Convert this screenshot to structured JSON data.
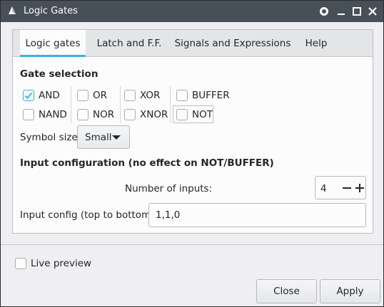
{
  "window": {
    "title": "Logic Gates"
  },
  "titlebar_buttons": [
    "pin-icon",
    "minimize-icon",
    "maximize-icon",
    "close-icon"
  ],
  "tabs": [
    {
      "label": "Logic gates",
      "active": true
    },
    {
      "label": "Latch and F.F.",
      "active": false
    },
    {
      "label": "Signals and Expressions",
      "active": false
    },
    {
      "label": "Help",
      "active": false
    }
  ],
  "gate_selection": {
    "title": "Gate selection",
    "gates": [
      {
        "label": "AND",
        "checked": true
      },
      {
        "label": "OR",
        "checked": false
      },
      {
        "label": "XOR",
        "checked": false
      },
      {
        "label": "BUFFER",
        "checked": false
      },
      {
        "label": "NAND",
        "checked": false
      },
      {
        "label": "NOR",
        "checked": false
      },
      {
        "label": "XNOR",
        "checked": false
      },
      {
        "label": "NOT",
        "checked": false
      }
    ]
  },
  "symbol_size": {
    "label": "Symbol size:",
    "value": "Small"
  },
  "input_config": {
    "title": "Input configuration (no effect on NOT/BUFFER)",
    "num_inputs_label": "Number of inputs:",
    "num_inputs_value": "4",
    "config_label": "Input config (top to bottom):",
    "config_value": "1,1,0"
  },
  "live_preview": {
    "label": "Live preview",
    "checked": false
  },
  "buttons": {
    "close": "Close",
    "apply": "Apply"
  },
  "colors": {
    "accent": "#3daee9",
    "titlebar": "#475057"
  }
}
